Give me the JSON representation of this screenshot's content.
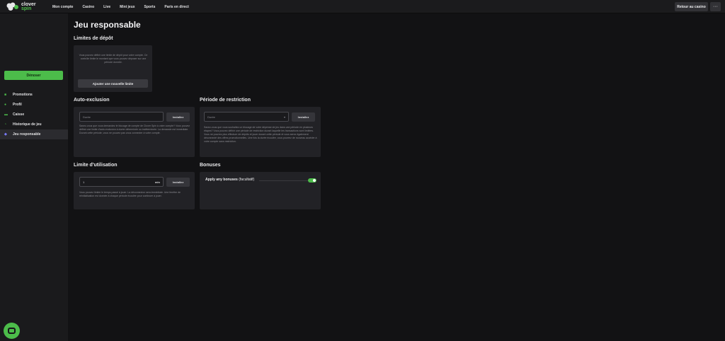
{
  "brand": {
    "line1": "clover",
    "line2": "spin"
  },
  "nav": [
    {
      "label": "Mon compte"
    },
    {
      "label": "Casino"
    },
    {
      "label": "Live"
    },
    {
      "label": "Mini jeux"
    },
    {
      "label": "Sports"
    },
    {
      "label": "Paris en direct"
    }
  ],
  "header": {
    "back_label": "Retour au casino",
    "more_label": "···"
  },
  "sidebar": {
    "deposit_label": "Dénoser",
    "items": [
      {
        "label": "Promotions",
        "icon": "gift-icon"
      },
      {
        "label": "Profil",
        "icon": "user-icon"
      },
      {
        "label": "Caisse",
        "icon": "wallet-icon"
      },
      {
        "label": "Historique de jeu",
        "icon": "history-icon"
      },
      {
        "label": "Jeu responsable",
        "icon": "shield-icon"
      }
    ]
  },
  "page": {
    "title": "Jeu responsable"
  },
  "deposit_limits": {
    "title": "Limites de dépôt",
    "description": "Vous pouvez définir une limite de dépôt pour votre compte. Ce contrôle limite le montant que vous pouvez déposer sur une période donnée.",
    "add_button": "Ajouter une nouvelle limite"
  },
  "self_exclusion": {
    "title": "Auto-exclusion",
    "input_placeholder": "Durée",
    "button": "Installez",
    "description": "Savez-vous que vous demandez le blocage de compte de Clover Spin à votre compte? Vous pouvez définir une limite d'auto-exclusion à durée déterminée ou indéterminée. La demande est immédiate. Durant cette période, vous ne pouvez pas vous connecter à votre compte."
  },
  "restriction_period": {
    "title": "Période de restriction",
    "input_placeholder": "Durée",
    "button": "Installez",
    "description": "Savez-vous que vous souhaitez un blocage de votre dépense de jeu dans une période en plusieurs étapes? Vous pouvez définir une période de restriction durant laquelle les transactions sont limitées. Vous ne pourrez plus effectuer de dépôts et jouer durant cette période et vous serez également déconnecté des offres promotionnelles. Une fois la durée écoulée, vous pourrez de nouveau accéder à votre compte sans restriction."
  },
  "usage_limit": {
    "title": "Limite d'utilisation",
    "input_value": "1",
    "unit": "min",
    "button": "Installez",
    "description": "Vous pouvez limiter le temps passé à jouer. La déconnexion sera immédiate. Une fenêtre de réinitialisation est donnée à chaque période écoulée pour continuer à jouer."
  },
  "bonuses": {
    "title": "Bonuses",
    "label_bold": "Apply any bonuses",
    "label_rest": " (facultatif)",
    "enabled": true
  },
  "colors": {
    "accent": "#4cbc4a",
    "background": "#121214",
    "card": "#222226",
    "sidebar": "#1a1a1c"
  },
  "chat": {
    "icon": "chat-icon"
  }
}
